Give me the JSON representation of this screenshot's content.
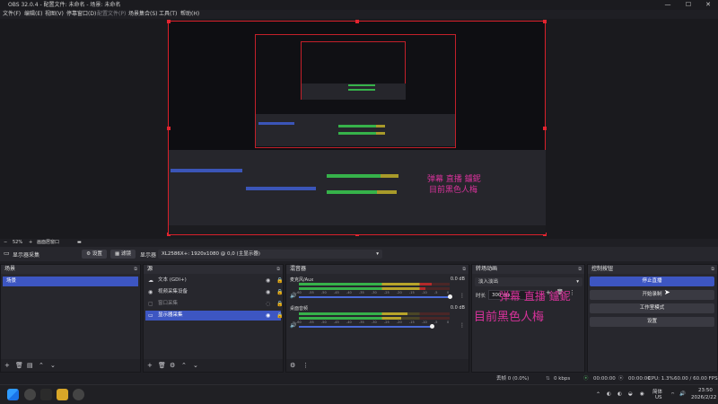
{
  "window": {
    "title": "OBS 32.0.4 - 配置文件: 未命名 - 场景: 未命名",
    "minimize": "—",
    "maximize": "☐",
    "close": "✕"
  },
  "menu": {
    "file": "文件(F)",
    "edit": "编辑(E)",
    "view": "视图(V)",
    "dock": "停靠窗口(D)",
    "profile": "配置文件(P)",
    "scene_collection": "场景集合(S)",
    "tools": "工具(T)",
    "help": "帮助(H)"
  },
  "zoom": {
    "value": "52%",
    "label": "画面居窗口"
  },
  "source_toolbar": {
    "settings_label": "设置",
    "filters_label": "滤镜",
    "display_label": "显示器",
    "display_value": "XL2586X+: 1920x1080 @ 0,0 (主显示器)"
  },
  "scenes": {
    "title": "场景",
    "items": [
      "场景"
    ]
  },
  "sources": {
    "title": "源",
    "items": [
      {
        "icon": "☁",
        "label": "文本 (GDI+)"
      },
      {
        "icon": "◉",
        "label": "视频采集设备"
      },
      {
        "icon": "▢",
        "label": "窗口采集"
      },
      {
        "icon": "▭",
        "label": "显示器采集"
      }
    ]
  },
  "mixer": {
    "title": "混音器",
    "ticks": [
      "-60",
      "-55",
      "-50",
      "-45",
      "-40",
      "-35",
      "-30",
      "-25",
      "-20",
      "-15",
      "-10",
      "-5",
      "0"
    ],
    "channels": [
      {
        "name": "麦克风/Aux",
        "db": "0.0 dB",
        "level": 0.88
      },
      {
        "name": "桌面音频",
        "db": "0.0 dB",
        "level": 0.72
      }
    ]
  },
  "transitions": {
    "title": "转场动画",
    "type": "淡入淡出",
    "duration_label": "时长",
    "duration_value": "300 ms"
  },
  "controls": {
    "title": "控制按钮",
    "stop_stream": "停止直播",
    "start_record": "开始录制",
    "studio_mode": "工作室模式",
    "settings": "设置"
  },
  "watermark": {
    "line1": "弹幕 直播 鑪鈮",
    "line2": "目前黑色人梅"
  },
  "status": {
    "dropped": "丢帧 0 (0.0%)",
    "bitrate": "0 kbps",
    "rec_time": "00:00:00",
    "stream_time": "00:00:00",
    "cpu": "CPU: 1.3%",
    "fps": "60.00 / 60.00 FPS"
  },
  "taskbar": {
    "ime": "简体",
    "region": "US",
    "time": "23:50",
    "date": "2026/2/22"
  },
  "colors": {
    "accent": "#3d56c2",
    "selection_border": "#d8202a",
    "watermark": "#d6329a"
  }
}
